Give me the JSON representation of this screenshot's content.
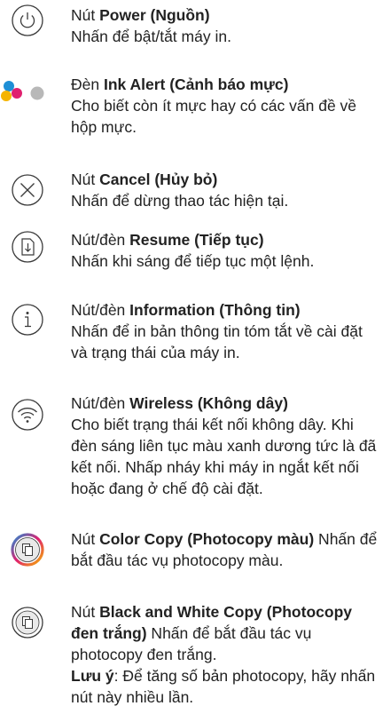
{
  "items": [
    {
      "prefix": "Nút ",
      "name": "Power (Nguồn)",
      "desc": "Nhấn để bật/tắt máy in.",
      "icon": "power-icon"
    },
    {
      "prefix": "Đèn ",
      "name": "Ink Alert (Cảnh báo mực)",
      "desc": "Cho biết còn ít mực hay có các vấn đề về hộp mực.",
      "icon": "ink-alert-icon"
    },
    {
      "prefix": "Nút ",
      "name": "Cancel (Hủy bỏ)",
      "desc": "Nhấn để dừng thao tác hiện tại.",
      "icon": "cancel-icon"
    },
    {
      "prefix": "Nút/đèn ",
      "name": "Resume (Tiếp tục)",
      "desc": "Nhấn khi sáng để tiếp tục một lệnh.",
      "icon": "resume-icon"
    },
    {
      "prefix": "Nút/đèn ",
      "name": "Information (Thông tin)",
      "desc": "Nhấn để in bản thông tin tóm tắt về cài đặt và trạng thái của máy in.",
      "icon": "information-icon"
    },
    {
      "prefix": "Nút/đèn ",
      "name": "Wireless (Không dây)",
      "desc": "Cho biết trạng thái kết nối không dây. Khi đèn sáng liên tục màu xanh dương tức là đã kết nối. Nhấp nháy khi máy in ngắt kết nối hoặc đang ở chế độ cài đặt.",
      "icon": "wireless-icon"
    },
    {
      "prefix": "Nút ",
      "name": "Color Copy (Photocopy màu)",
      "desc": " Nhấn để bắt đầu tác vụ photocopy màu.",
      "icon": "color-copy-icon"
    },
    {
      "prefix": "Nút ",
      "name": "Black and White Copy (Photocopy đen trắng)",
      "desc": " Nhấn để bắt đầu tác vụ photocopy đen trắng.",
      "icon": "bw-copy-icon"
    }
  ],
  "note": {
    "label": "Lưu ý",
    "text": ": Để tăng số bản photocopy, hãy nhấn nút này nhiều lần."
  },
  "colors": {
    "cyan": "#1e8fd6",
    "magenta": "#e0206e",
    "yellow": "#f5b400",
    "gray": "#b8b8b8",
    "stroke": "#3a3a3a"
  }
}
